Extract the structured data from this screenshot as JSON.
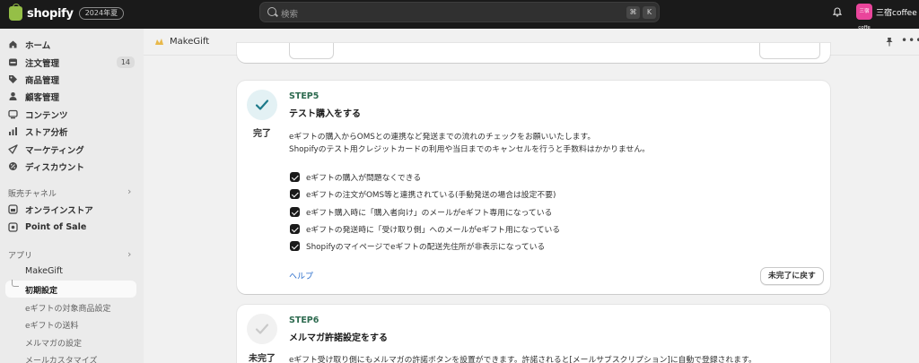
{
  "topbar": {
    "logo_text": "shopify",
    "edition_badge": "2024年夏",
    "search_placeholder": "検索",
    "shortcut_keys": [
      "⌘",
      "K"
    ],
    "avatar_text": "三宿coffe",
    "store_name": "三宿coffee",
    "colors": {
      "bar": "#1a1a1a",
      "logo_green": "#95bf47",
      "avatar_pink": "#e9459b"
    }
  },
  "sidebar": {
    "main_items": [
      {
        "label": "ホーム",
        "icon": "home-icon"
      },
      {
        "label": "注文管理",
        "icon": "orders-icon",
        "count": "14"
      },
      {
        "label": "商品管理",
        "icon": "tag-icon"
      },
      {
        "label": "顧客管理",
        "icon": "person-icon"
      },
      {
        "label": "コンテンツ",
        "icon": "content-icon"
      },
      {
        "label": "ストア分析",
        "icon": "analytics-icon"
      },
      {
        "label": "マーケティング",
        "icon": "marketing-icon"
      },
      {
        "label": "ディスカウント",
        "icon": "discount-icon"
      }
    ],
    "sales_channels_heading": "販売チャネル",
    "sales_channels": [
      {
        "label": "オンラインストア",
        "icon": "storefront-icon"
      },
      {
        "label": "Point of Sale",
        "icon": "pos-icon"
      }
    ],
    "apps_heading": "アプリ",
    "app_name": "MakeGift",
    "app_subitems": [
      {
        "label": "初期設定",
        "active": true
      },
      {
        "label": "eギフトの対象商品設定"
      },
      {
        "label": "eギフトの送料"
      },
      {
        "label": "メルマガの設定"
      },
      {
        "label": "メールカスタマイズ"
      }
    ]
  },
  "app_header": {
    "title": "MakeGift"
  },
  "steps": [
    {
      "step_label": "STEP5",
      "title": "テスト購入をする",
      "status": "完了",
      "status_icon": "check-icon",
      "description": [
        "eギフトの購入からOMSとの連携など発送までの流れのチェックをお願いいたします。",
        "Shopifyのテスト用クレジットカードの利用や当日までのキャンセルを行うと手数料はかかりません。"
      ],
      "checklist": [
        {
          "label": "eギフトの購入が問題なくできる",
          "checked": true
        },
        {
          "label": "eギフトの注文がOMS等と連携されている(手動発送の場合は設定不要)",
          "checked": true
        },
        {
          "label": "eギフト購入時に「購入者向け」のメールがeギフト専用になっている",
          "checked": true
        },
        {
          "label": "eギフトの発送時に「受け取り側」へのメールがeギフト用になっている",
          "checked": true
        },
        {
          "label": "Shopifyのマイページでeギフトの配送先住所が非表示になっている",
          "checked": true
        }
      ],
      "help_label": "ヘルプ",
      "action_label": "未完了に戻す",
      "accent": "#e3f1f4"
    },
    {
      "step_label": "STEP6",
      "title": "メルマガ許諾設定をする",
      "status": "未完了",
      "status_icon": "check-icon",
      "description": [
        "eギフト受け取り側にもメルマガの許諾ボタンを設置ができます。許諾されると[メールサブスクリプション]に自動で登録されます。"
      ]
    }
  ]
}
